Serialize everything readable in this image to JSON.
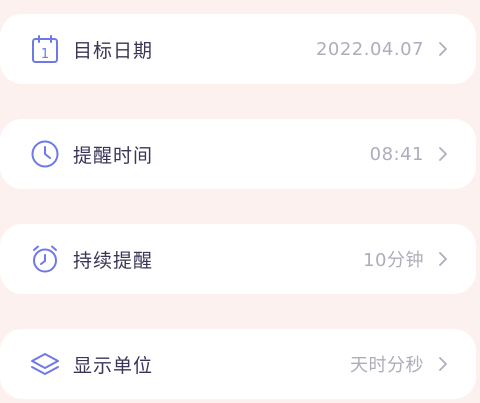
{
  "accent_color": "#6e79e8",
  "rows": [
    {
      "icon": "calendar-icon",
      "label": "目标日期",
      "value": "2022.04.07",
      "calendar_day": "1"
    },
    {
      "icon": "clock-icon",
      "label": "提醒时间",
      "value": "08:41"
    },
    {
      "icon": "alarm-clock-icon",
      "label": "持续提醒",
      "value": "10分钟"
    },
    {
      "icon": "layers-icon",
      "label": "显示单位",
      "value": "天时分秒"
    }
  ]
}
